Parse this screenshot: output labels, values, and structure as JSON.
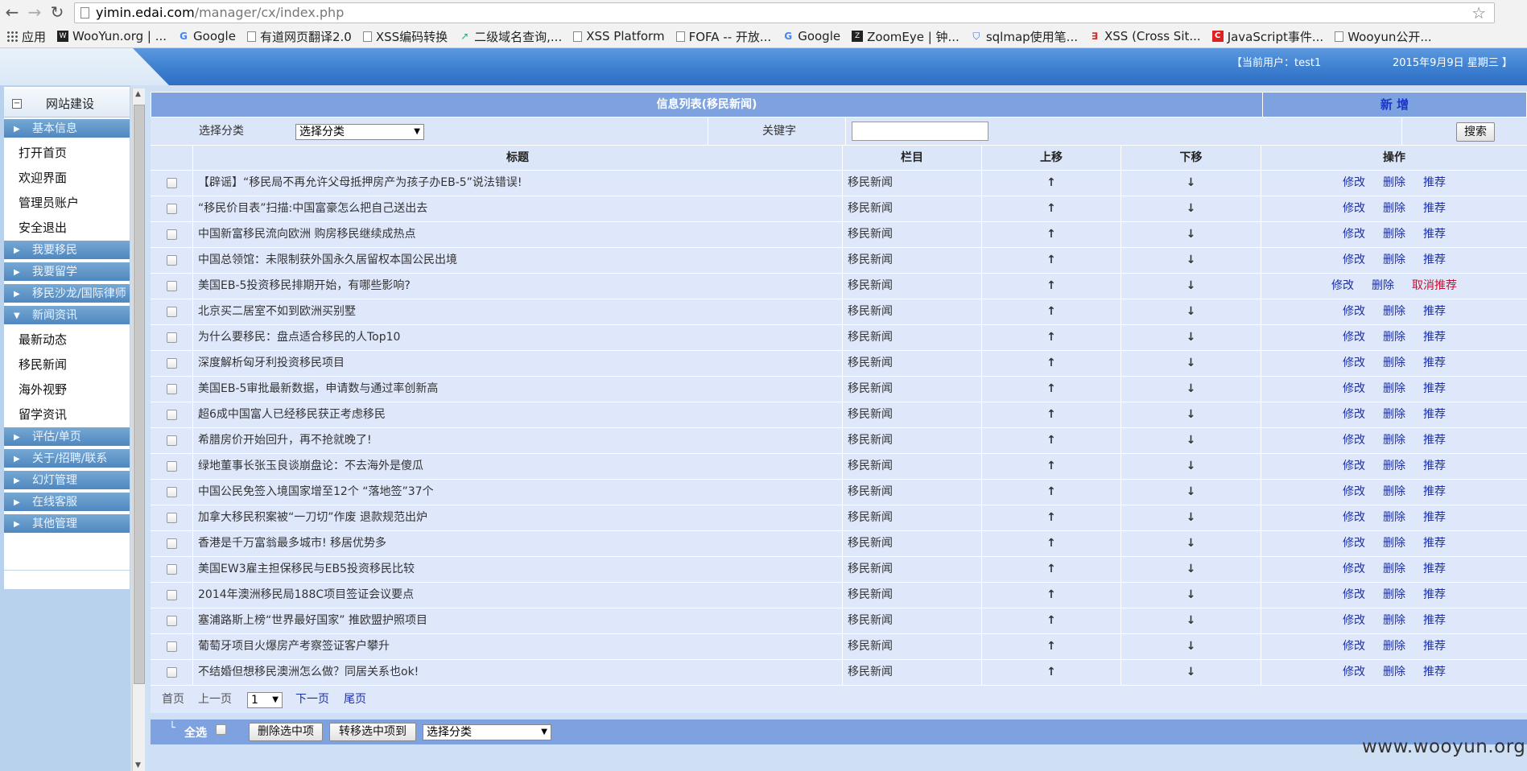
{
  "browser": {
    "url_host": "yimin.edai.com",
    "url_path": "/manager/cx/index.php",
    "bookmarks": [
      "应用",
      "WooYun.org | ...",
      "Google",
      "有道网页翻译2.0",
      "XSS编码转换",
      "二级域名查询,...",
      "XSS Platform",
      "FOFA -- 开放...",
      "Google",
      "ZoomEye | 钟...",
      "sqlmap使用笔...",
      "XSS (Cross Sit...",
      "JavaScript事件...",
      "Wooyun公开..."
    ]
  },
  "header": {
    "current_user": "【当前用户：test1",
    "date": "2015年9月9日 星期三 】"
  },
  "sidebar": {
    "title": "网站建设",
    "menu": [
      {
        "type": "cat",
        "label": "基本信息",
        "expanded": false
      },
      {
        "type": "sub",
        "label": "打开首页"
      },
      {
        "type": "sub",
        "label": "欢迎界面"
      },
      {
        "type": "sub",
        "label": "管理员账户"
      },
      {
        "type": "sub",
        "label": "安全退出"
      },
      {
        "type": "cat",
        "label": "我要移民",
        "expanded": false
      },
      {
        "type": "cat",
        "label": "我要留学",
        "expanded": false
      },
      {
        "type": "cat",
        "label": "移民沙龙/国际律师",
        "expanded": false
      },
      {
        "type": "cat",
        "label": "新闻资讯",
        "expanded": true
      },
      {
        "type": "sub",
        "label": "最新动态"
      },
      {
        "type": "sub",
        "label": "移民新闻"
      },
      {
        "type": "sub",
        "label": "海外视野"
      },
      {
        "type": "sub",
        "label": "留学资讯"
      },
      {
        "type": "cat",
        "label": "评估/单页",
        "expanded": false
      },
      {
        "type": "cat",
        "label": "关于/招聘/联系",
        "expanded": false
      },
      {
        "type": "cat",
        "label": "幻灯管理",
        "expanded": false
      },
      {
        "type": "cat",
        "label": "在线客服",
        "expanded": false
      },
      {
        "type": "cat",
        "label": "其他管理",
        "expanded": false
      }
    ]
  },
  "main": {
    "title": "信息列表(移民新闻)",
    "new_label": "新 增",
    "filter": {
      "category_label": "选择分类",
      "category_select": "选择分类",
      "keyword_label": "关键字",
      "keyword_value": "",
      "search_label": "搜索"
    },
    "columns": {
      "title": "标题",
      "column": "栏目",
      "up": "上移",
      "down": "下移",
      "ops": "操作"
    },
    "up_symbol": "↑",
    "down_symbol": "↓",
    "op_edit": "修改",
    "op_delete": "删除",
    "rows": [
      {
        "title": "【辟谣】“移民局不再允许父母抵押房产为孩子办EB-5”说法错误!",
        "column": "移民新闻",
        "recommend": "推荐",
        "recommended": false
      },
      {
        "title": "“移民价目表”扫描:中国富豪怎么把自己送出去",
        "column": "移民新闻",
        "recommend": "推荐",
        "recommended": false
      },
      {
        "title": "中国新富移民流向欧洲 购房移民继续成热点",
        "column": "移民新闻",
        "recommend": "推荐",
        "recommended": false
      },
      {
        "title": "中国总领馆：未限制获外国永久居留权本国公民出境",
        "column": "移民新闻",
        "recommend": "推荐",
        "recommended": false
      },
      {
        "title": "美国EB-5投资移民排期开始，有哪些影响?",
        "column": "移民新闻",
        "recommend": "取消推荐",
        "recommended": true
      },
      {
        "title": "北京买二居室不如到欧洲买别墅",
        "column": "移民新闻",
        "recommend": "推荐",
        "recommended": false
      },
      {
        "title": "为什么要移民：盘点适合移民的人Top10",
        "column": "移民新闻",
        "recommend": "推荐",
        "recommended": false
      },
      {
        "title": "深度解析匈牙利投资移民项目",
        "column": "移民新闻",
        "recommend": "推荐",
        "recommended": false
      },
      {
        "title": "美国EB-5审批最新数据，申请数与通过率创新高",
        "column": "移民新闻",
        "recommend": "推荐",
        "recommended": false
      },
      {
        "title": "超6成中国富人已经移民获正考虑移民",
        "column": "移民新闻",
        "recommend": "推荐",
        "recommended": false
      },
      {
        "title": "希腊房价开始回升，再不抢就晚了!",
        "column": "移民新闻",
        "recommend": "推荐",
        "recommended": false
      },
      {
        "title": "绿地董事长张玉良谈崩盘论：不去海外是傻瓜",
        "column": "移民新闻",
        "recommend": "推荐",
        "recommended": false
      },
      {
        "title": "中国公民免签入境国家增至12个 “落地签”37个",
        "column": "移民新闻",
        "recommend": "推荐",
        "recommended": false
      },
      {
        "title": "加拿大移民积案被“一刀切”作废 退款规范出炉",
        "column": "移民新闻",
        "recommend": "推荐",
        "recommended": false
      },
      {
        "title": "香港是千万富翁最多城市! 移居优势多",
        "column": "移民新闻",
        "recommend": "推荐",
        "recommended": false
      },
      {
        "title": "美国EW3雇主担保移民与EB5投资移民比较",
        "column": "移民新闻",
        "recommend": "推荐",
        "recommended": false
      },
      {
        "title": "2014年澳洲移民局188C项目签证会议要点",
        "column": "移民新闻",
        "recommend": "推荐",
        "recommended": false
      },
      {
        "title": "塞浦路斯上榜“世界最好国家” 推欧盟护照项目",
        "column": "移民新闻",
        "recommend": "推荐",
        "recommended": false
      },
      {
        "title": "葡萄牙项目火爆房产考察签证客户攀升",
        "column": "移民新闻",
        "recommend": "推荐",
        "recommended": false
      },
      {
        "title": "不结婚但想移民澳洲怎么做？同居关系也ok!",
        "column": "移民新闻",
        "recommend": "推荐",
        "recommended": false
      }
    ],
    "pager": {
      "first": "首页",
      "prev": "上一页",
      "page": "1",
      "next": "下一页",
      "last": "尾页"
    },
    "footer": {
      "corner": "└",
      "select_all": "全选",
      "delete_selected": "删除选中项",
      "move_selected": "转移选中项到",
      "move_target": "选择分类"
    }
  },
  "watermark": "www.wooyun.org"
}
